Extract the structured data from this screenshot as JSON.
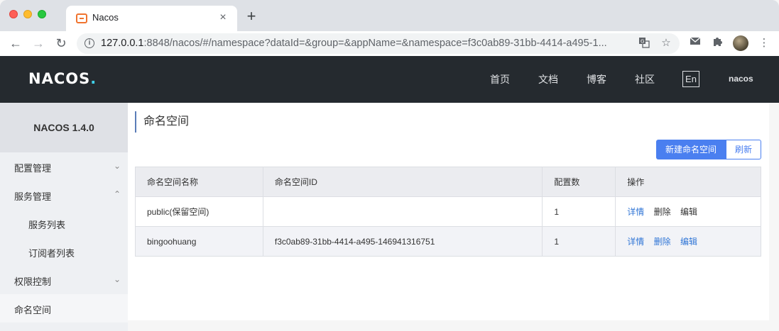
{
  "browser": {
    "tab_title": "Nacos",
    "tab_close": "×",
    "new_tab": "+",
    "url_host": "127.0.0.1",
    "url_rest": ":8848/nacos/#/namespace?dataId=&group=&appName=&namespace=f3c0ab89-31bb-4414-a495-1...",
    "icons": [
      "back-icon",
      "forward-icon",
      "reload-icon",
      "info-icon",
      "translate-icon",
      "star-icon",
      "mail-icon",
      "extensions-icon",
      "menu-icon"
    ]
  },
  "header": {
    "logo": "NACOS",
    "logo_dot": ".",
    "nav": [
      "首页",
      "文档",
      "博客",
      "社区"
    ],
    "lang": "En",
    "user": "nacos"
  },
  "sidebar": {
    "title": "NACOS 1.4.0",
    "items": [
      {
        "label": "配置管理",
        "chevron": "⌄"
      },
      {
        "label": "服务管理",
        "chevron": "⌃"
      },
      {
        "label": "服务列表"
      },
      {
        "label": "订阅者列表"
      },
      {
        "label": "权限控制",
        "chevron": "⌄"
      },
      {
        "label": "命名空间"
      }
    ]
  },
  "main": {
    "title": "命名空间",
    "new_button": "新建命名空间",
    "refresh_button": "刷新",
    "table": {
      "headers": [
        "命名空间名称",
        "命名空间ID",
        "配置数",
        "操作"
      ],
      "rows": [
        {
          "name": "public(保留空间)",
          "id": "",
          "count": "1",
          "ops": [
            "详情",
            "删除",
            "编辑"
          ]
        },
        {
          "name": "bingoohuang",
          "id": "f3c0ab89-31bb-4414-a495-146941316751",
          "count": "1",
          "ops": [
            "详情",
            "删除",
            "编辑"
          ]
        }
      ]
    }
  },
  "colors": {
    "header_bg": "#252a2f",
    "accent": "#4a7ff0",
    "link": "#3176d6"
  }
}
